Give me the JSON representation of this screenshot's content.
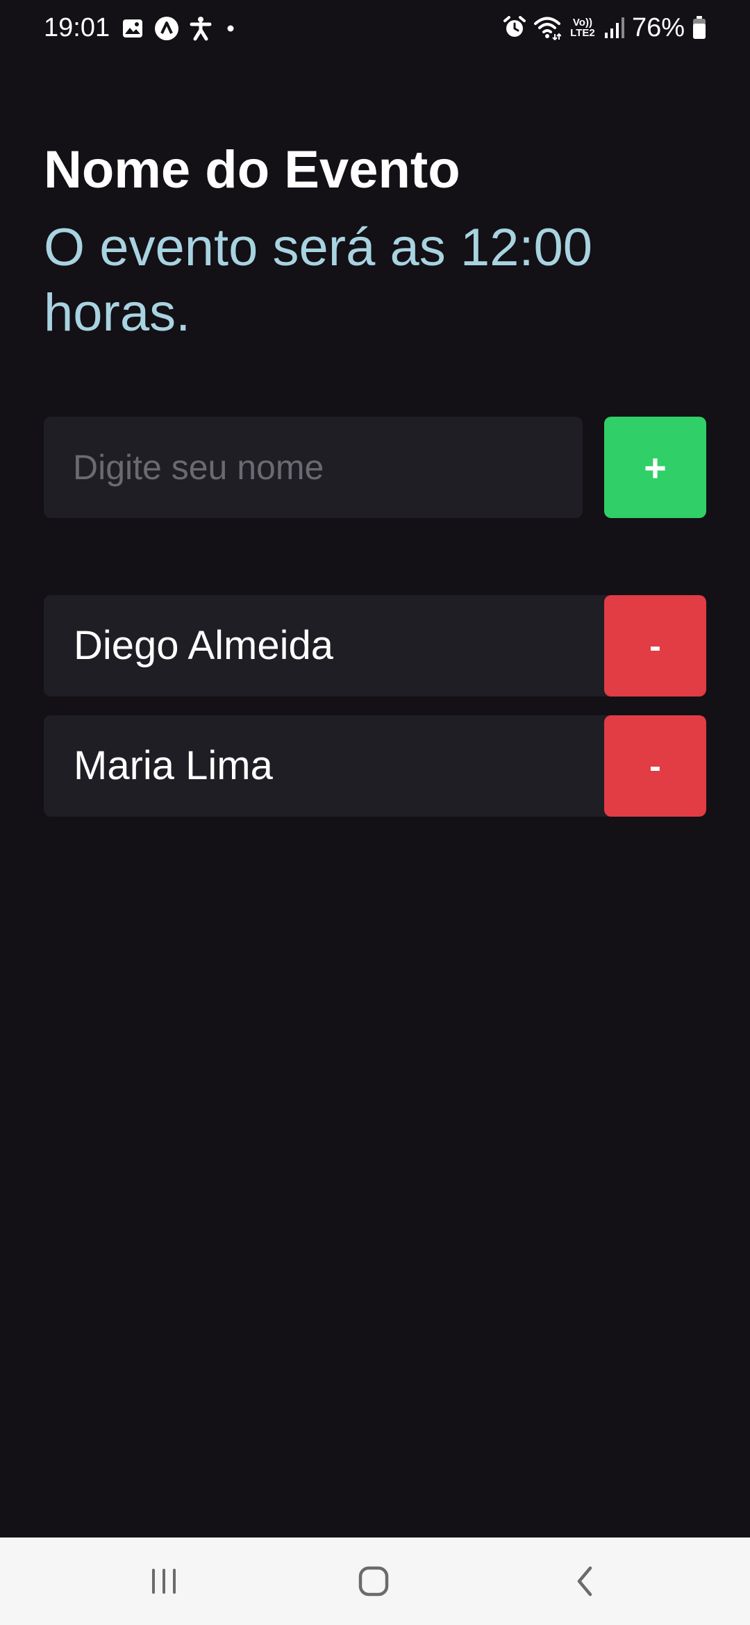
{
  "status_bar": {
    "time": "19:01",
    "battery": "76%",
    "network_label_top": "Vo))",
    "network_label_bottom": "LTE2",
    "icons": [
      "gallery-icon",
      "app-a-icon",
      "accessibility-icon",
      "dot-icon",
      "alarm-icon",
      "wifi-icon",
      "signal-icon",
      "battery-icon"
    ]
  },
  "event": {
    "title": "Nome do Evento",
    "subtitle": "O evento será as 12:00 horas."
  },
  "form": {
    "input_placeholder": "Digite seu nome",
    "input_value": "",
    "add_label": "+"
  },
  "participants": [
    {
      "name": "Diego Almeida",
      "remove_label": "-"
    },
    {
      "name": "Maria Lima",
      "remove_label": "-"
    }
  ],
  "nav_bar": {
    "icons": [
      "recent-apps-icon",
      "home-icon",
      "back-icon"
    ]
  },
  "colors": {
    "background": "#131016",
    "card": "#1f1e25",
    "accent_green": "#31cf67",
    "accent_red": "#e23c44",
    "subtitle": "#a8d3e0"
  }
}
